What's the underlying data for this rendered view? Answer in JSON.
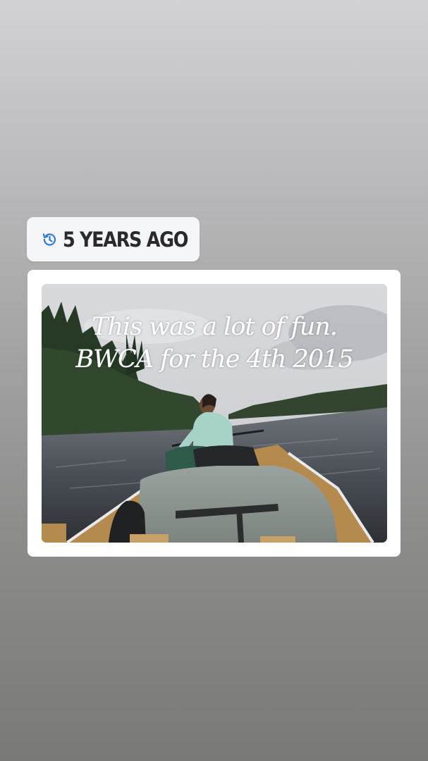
{
  "memory": {
    "icon": "history-clock-icon",
    "label": "5 YEARS AGO"
  },
  "photo": {
    "caption_lines": [
      "This was a lot of fun.",
      "BWCA for the 4th 2015"
    ]
  },
  "colors": {
    "badge_bg": "#f4f5f7",
    "icon_accent": "#2f7ad9",
    "card_bg": "#ffffff"
  }
}
